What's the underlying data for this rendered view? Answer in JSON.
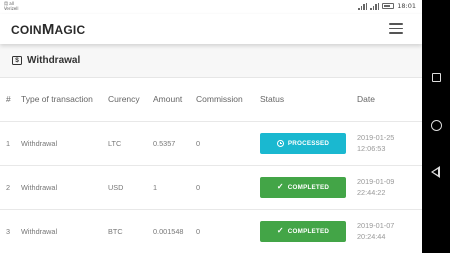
{
  "status_bar": {
    "carrier_line1": "用 all",
    "carrier_line2": "Verizell",
    "clock": "18:01"
  },
  "app": {
    "logo_prefix": "COIN",
    "logo_m": "M",
    "logo_suffix": "AGIC"
  },
  "page": {
    "title": "Withdrawal"
  },
  "table": {
    "headers": {
      "index": "#",
      "type": "Type of transaction",
      "currency": "Curency",
      "amount": "Amount",
      "commission": "Commission",
      "status": "Status",
      "date": "Date"
    },
    "rows": [
      {
        "index": "1",
        "type": "Withdrawal",
        "currency": "LTC",
        "amount": "0.5357",
        "commission": "0",
        "status": "PROCESSED",
        "date": "2019-01-25",
        "time": "12:06:53"
      },
      {
        "index": "2",
        "type": "Withdrawal",
        "currency": "USD",
        "amount": "1",
        "commission": "0",
        "status": "COMPLETED",
        "date": "2019-01-09",
        "time": "22:44:22"
      },
      {
        "index": "3",
        "type": "Withdrawal",
        "currency": "BTC",
        "amount": "0.001548",
        "commission": "0",
        "status": "COMPLETED",
        "date": "2019-01-07",
        "time": "20:24:44"
      }
    ]
  },
  "colors": {
    "processed": "#1ab8d0",
    "completed": "#43a547"
  },
  "icons": {
    "page_title_icon": "dollar-icon",
    "processed_icon": "clock-icon",
    "completed_icon": "check-icon"
  }
}
